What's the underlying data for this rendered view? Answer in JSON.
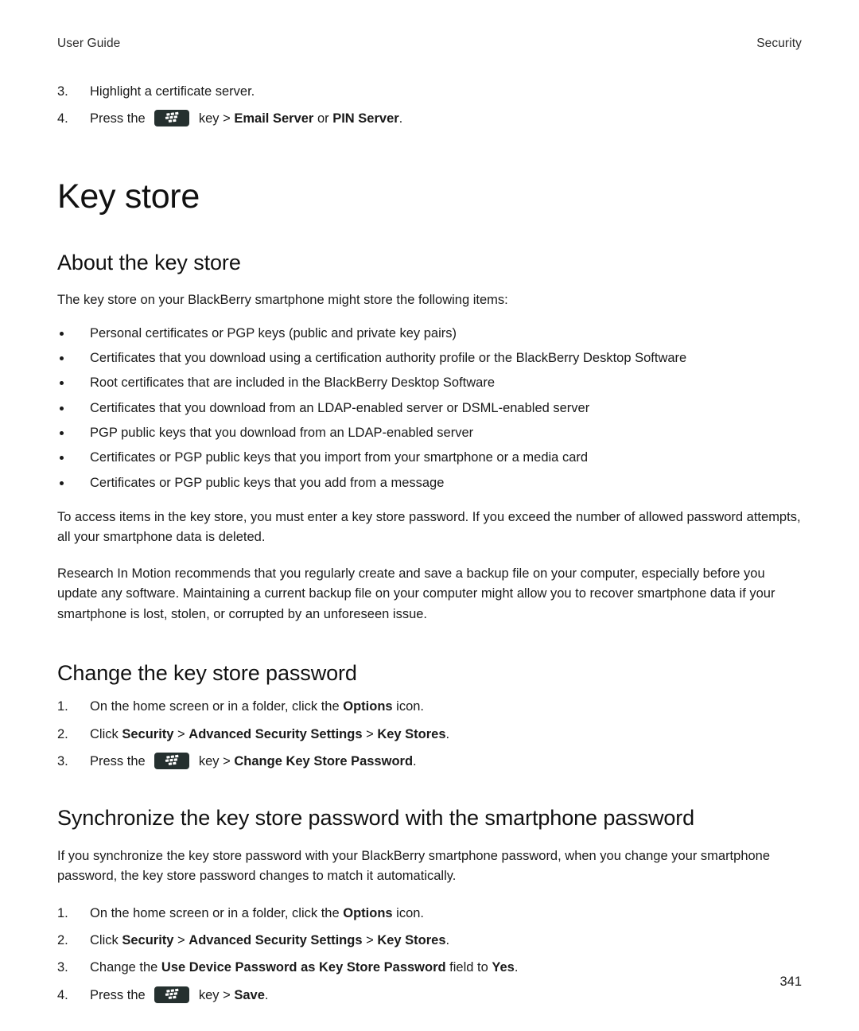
{
  "header": {
    "left": "User Guide",
    "right": "Security"
  },
  "top_steps": [
    {
      "num": "3.",
      "parts": [
        {
          "type": "text",
          "value": "Highlight a certificate server."
        }
      ]
    },
    {
      "num": "4.",
      "parts": [
        {
          "type": "text",
          "value": "Press the "
        },
        {
          "type": "bbkey",
          "value": "blackberry-menu-key"
        },
        {
          "type": "text",
          "value": " key > "
        },
        {
          "type": "bold",
          "value": "Email Server"
        },
        {
          "type": "text",
          "value": " or "
        },
        {
          "type": "bold",
          "value": "PIN Server"
        },
        {
          "type": "text",
          "value": "."
        }
      ]
    }
  ],
  "chapter_title": "Key store",
  "sections": [
    {
      "heading": "About the key store",
      "intro": "The key store on your BlackBerry smartphone might store the following items:",
      "bullets": [
        "Personal certificates or PGP keys (public and private key pairs)",
        "Certificates that you download using a certification authority profile or the BlackBerry Desktop Software",
        "Root certificates that are included in the BlackBerry Desktop Software",
        "Certificates that you download from an LDAP-enabled server or DSML-enabled server",
        "PGP public keys that you download from an LDAP-enabled server",
        "Certificates or PGP public keys that you import from your smartphone or a media card",
        "Certificates or PGP public keys that you add from a message"
      ],
      "paragraphs": [
        "To access items in the key store, you must enter a key store password. If you exceed the number of allowed password attempts, all your smartphone data is deleted.",
        "Research In Motion recommends that you regularly create and save a backup file on your computer, especially before you update any software. Maintaining a current backup file on your computer might allow you to recover smartphone data if your smartphone is lost, stolen, or corrupted by an unforeseen issue."
      ]
    }
  ],
  "change_password": {
    "heading": "Change the key store password",
    "steps": [
      {
        "num": "1.",
        "parts": [
          {
            "type": "text",
            "value": "On the home screen or in a folder, click the "
          },
          {
            "type": "bold",
            "value": "Options"
          },
          {
            "type": "text",
            "value": " icon."
          }
        ]
      },
      {
        "num": "2.",
        "parts": [
          {
            "type": "text",
            "value": "Click "
          },
          {
            "type": "bold",
            "value": "Security"
          },
          {
            "type": "text",
            "value": " > "
          },
          {
            "type": "bold",
            "value": "Advanced Security Settings"
          },
          {
            "type": "text",
            "value": " > "
          },
          {
            "type": "bold",
            "value": "Key Stores"
          },
          {
            "type": "text",
            "value": "."
          }
        ]
      },
      {
        "num": "3.",
        "parts": [
          {
            "type": "text",
            "value": "Press the "
          },
          {
            "type": "bbkey",
            "value": "blackberry-menu-key"
          },
          {
            "type": "text",
            "value": " key > "
          },
          {
            "type": "bold",
            "value": "Change Key Store Password"
          },
          {
            "type": "text",
            "value": "."
          }
        ]
      }
    ]
  },
  "synchronize": {
    "heading": "Synchronize the key store password with the smartphone password",
    "paragraph": "If you synchronize the key store password with your BlackBerry smartphone password, when you change your smartphone password, the key store password changes to match it automatically.",
    "steps": [
      {
        "num": "1.",
        "parts": [
          {
            "type": "text",
            "value": "On the home screen or in a folder, click the "
          },
          {
            "type": "bold",
            "value": "Options"
          },
          {
            "type": "text",
            "value": " icon."
          }
        ]
      },
      {
        "num": "2.",
        "parts": [
          {
            "type": "text",
            "value": "Click "
          },
          {
            "type": "bold",
            "value": "Security"
          },
          {
            "type": "text",
            "value": " > "
          },
          {
            "type": "bold",
            "value": "Advanced Security Settings"
          },
          {
            "type": "text",
            "value": " > "
          },
          {
            "type": "bold",
            "value": "Key Stores"
          },
          {
            "type": "text",
            "value": "."
          }
        ]
      },
      {
        "num": "3.",
        "parts": [
          {
            "type": "text",
            "value": "Change the "
          },
          {
            "type": "bold",
            "value": "Use Device Password as Key Store Password"
          },
          {
            "type": "text",
            "value": " field to "
          },
          {
            "type": "bold",
            "value": "Yes"
          },
          {
            "type": "text",
            "value": "."
          }
        ]
      },
      {
        "num": "4.",
        "parts": [
          {
            "type": "text",
            "value": "Press the "
          },
          {
            "type": "bbkey",
            "value": "blackberry-menu-key"
          },
          {
            "type": "text",
            "value": " key > "
          },
          {
            "type": "bold",
            "value": "Save"
          },
          {
            "type": "text",
            "value": "."
          }
        ]
      }
    ]
  },
  "page_number": "341",
  "colors": {
    "page_background": "#ffffff",
    "text": "#1a1a1a",
    "heading": "#111111",
    "header_text": "#2b2b2b",
    "bb_key_background": "#25302f",
    "bb_key_dots": "#ffffff"
  }
}
